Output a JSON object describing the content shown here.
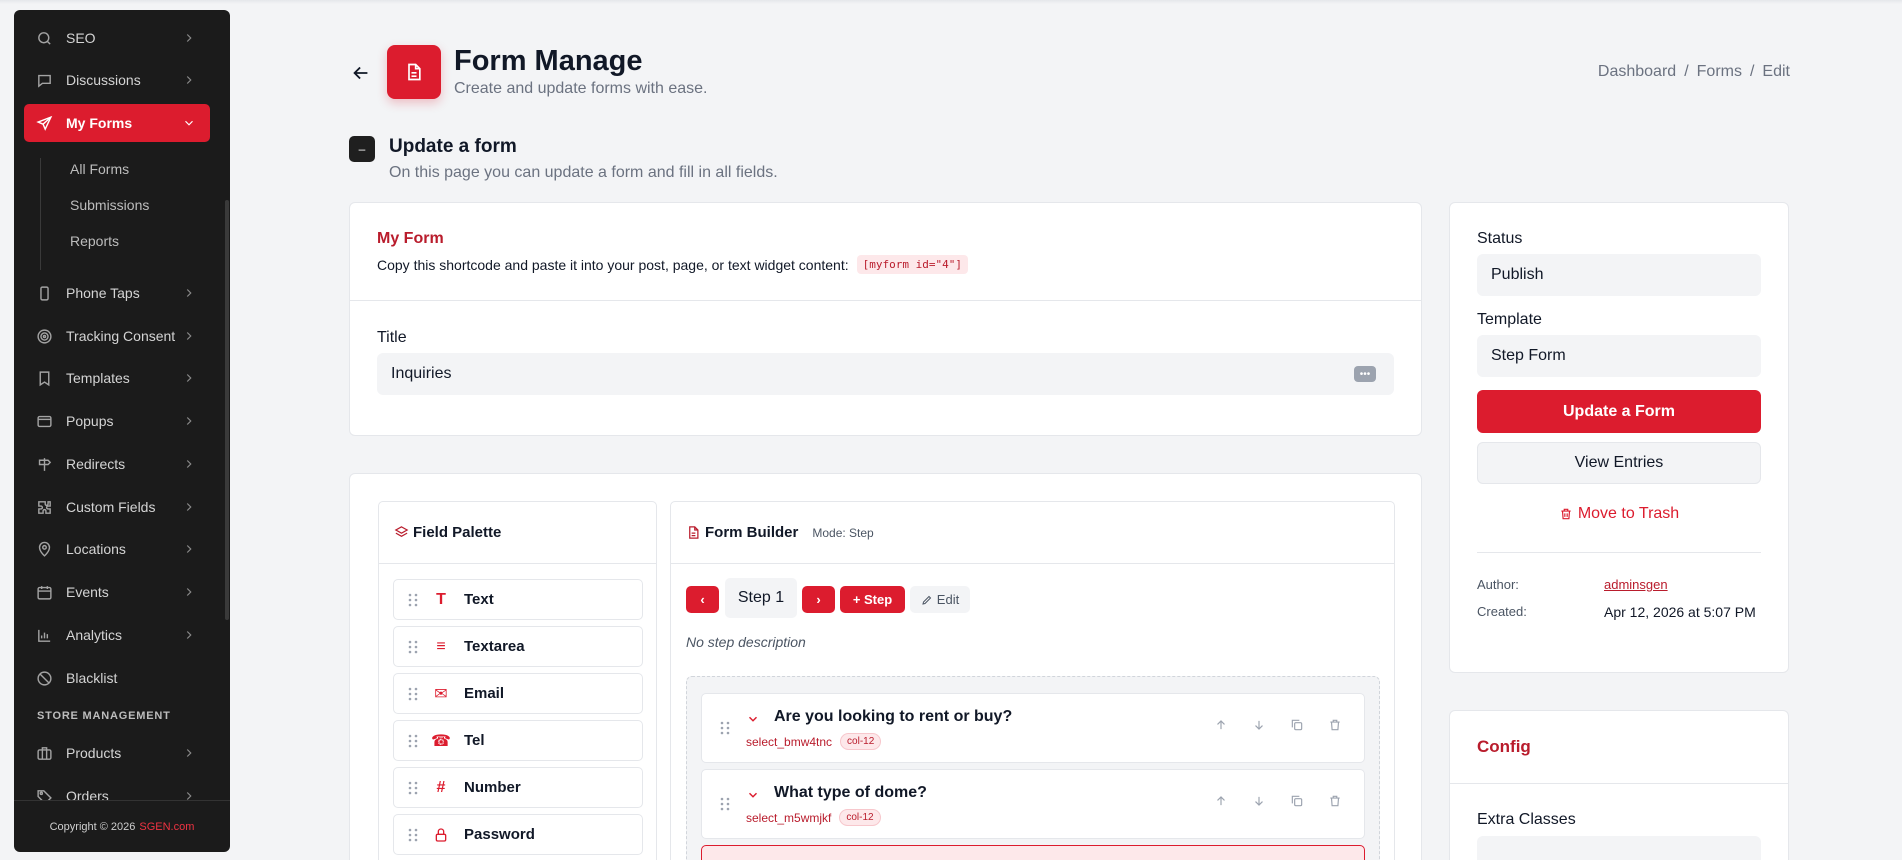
{
  "sidebar": {
    "items": [
      {
        "label": "SEO",
        "icon": "search-icon"
      },
      {
        "label": "Discussions",
        "icon": "chat-icon"
      },
      {
        "label": "My Forms",
        "icon": "send-icon",
        "active": true
      },
      {
        "label": "Phone Taps",
        "icon": "phone-icon"
      },
      {
        "label": "Tracking Consent",
        "icon": "target-icon"
      },
      {
        "label": "Templates",
        "icon": "bookmark-icon"
      },
      {
        "label": "Popups",
        "icon": "window-icon"
      },
      {
        "label": "Redirects",
        "icon": "signpost-icon"
      },
      {
        "label": "Custom Fields",
        "icon": "puzzle-icon"
      },
      {
        "label": "Locations",
        "icon": "map-pin-icon"
      },
      {
        "label": "Events",
        "icon": "calendar-icon"
      },
      {
        "label": "Analytics",
        "icon": "bar-chart-icon"
      },
      {
        "label": "Blacklist",
        "icon": "ban-icon"
      }
    ],
    "submenu": [
      "All Forms",
      "Submissions",
      "Reports"
    ],
    "section_label": "STORE MANAGEMENT",
    "store_items": [
      {
        "label": "Products",
        "icon": "briefcase-icon"
      },
      {
        "label": "Orders",
        "icon": "tag-icon"
      }
    ],
    "footer": {
      "text": "Copyright © 2026",
      "brand": "SGEN.com"
    }
  },
  "header": {
    "title": "Form Manage",
    "subtitle": "Create and update forms with ease.",
    "breadcrumbs": [
      "Dashboard",
      "/",
      "Forms",
      "/",
      "Edit"
    ]
  },
  "section": {
    "badge": "–",
    "title": "Update a form",
    "subtitle": "On this page you can update a form and fill in all fields."
  },
  "form_card": {
    "label": "My Form",
    "shortcode_text": "Copy this shortcode and paste it into your post, page, or text widget content:",
    "shortcode": "[myform id=\"4\"]",
    "title_label": "Title",
    "title_value": "Inquiries",
    "dots": "•••"
  },
  "palette": {
    "title": "Field Palette",
    "items": [
      {
        "label": "Text",
        "glyph": "T"
      },
      {
        "label": "Textarea",
        "glyph": "≡"
      },
      {
        "label": "Email",
        "glyph": "✉"
      },
      {
        "label": "Tel",
        "glyph": "☎"
      },
      {
        "label": "Number",
        "glyph": "#"
      },
      {
        "label": "Password",
        "glyph": "🔒"
      }
    ]
  },
  "builder": {
    "title": "Form Builder",
    "mode": "Mode: Step",
    "prev": "‹",
    "next": "›",
    "step_label": "Step 1",
    "add_step": "+ Step",
    "edit": "Edit",
    "no_desc": "No step description",
    "questions": [
      {
        "title": "Are you looking to rent or buy?",
        "key": "select_bmw4tnc",
        "col": "col-12"
      },
      {
        "title": "What type of dome?",
        "key": "select_m5wmjkf",
        "col": "col-12"
      }
    ]
  },
  "publish": {
    "status_label": "Status",
    "status_value": "Publish",
    "template_label": "Template",
    "template_value": "Step Form",
    "update_btn": "Update a Form",
    "view_btn": "View Entries",
    "trash": "Move to Trash",
    "author_label": "Author:",
    "author_value": "adminsgen",
    "created_label": "Created:",
    "created_value": "Apr 12, 2026 at 5:07 PM"
  },
  "config": {
    "title": "Config",
    "extra_classes_label": "Extra Classes"
  },
  "colors": {
    "accent": "#dc1c2e",
    "sidebar_bg": "#1b1b1b",
    "page_bg": "#f3f4f6"
  }
}
